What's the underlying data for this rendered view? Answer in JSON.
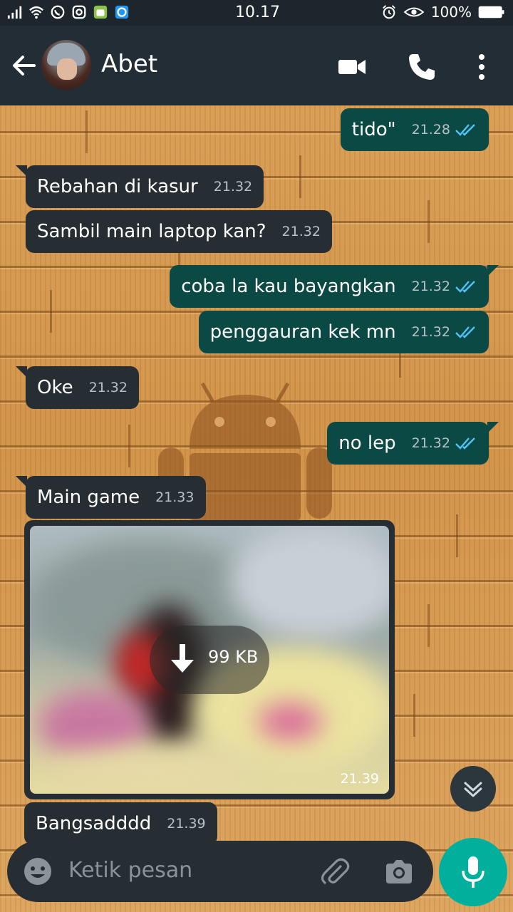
{
  "status_bar": {
    "time": "10.17",
    "battery": "100%",
    "icons": [
      "signal-icon",
      "wifi-icon",
      "whatsapp-icon",
      "instagram-icon",
      "android-app-icon",
      "app-icon",
      "alarm-icon",
      "eye-icon",
      "battery-icon"
    ]
  },
  "header": {
    "contact_name": "Abet",
    "icons": [
      "back-arrow-icon",
      "video-call-icon",
      "phone-icon",
      "more-vert-icon"
    ]
  },
  "messages": [
    {
      "direction": "out",
      "text": "tido\"",
      "time": "21.28",
      "ticks": true
    },
    {
      "direction": "in",
      "text": "Rebahan di kasur",
      "time": "21.32"
    },
    {
      "direction": "in",
      "text": "Sambil main laptop kan?",
      "time": "21.32"
    },
    {
      "direction": "out",
      "text": "coba la kau bayangkan",
      "time": "21.32",
      "ticks": true
    },
    {
      "direction": "out",
      "text": "penggauran kek mn",
      "time": "21.32",
      "ticks": true
    },
    {
      "direction": "in",
      "text": "Oke",
      "time": "21.32"
    },
    {
      "direction": "out",
      "text": "no lep",
      "time": "21.32",
      "ticks": true
    },
    {
      "direction": "in",
      "text": "Main game",
      "time": "21.33"
    },
    {
      "direction": "in",
      "type": "image",
      "size": "99 KB",
      "time": "21.39"
    },
    {
      "direction": "in",
      "text": "Bangsadddd",
      "time": "21.39"
    }
  ],
  "input": {
    "placeholder": "Ketik pesan"
  },
  "colors": {
    "incoming_bubble": "#262e34",
    "outgoing_bubble": "#0b4a44",
    "read_ticks": "#4fc3f7",
    "mic_button": "#00af9c",
    "app_bar": "#232d36"
  }
}
